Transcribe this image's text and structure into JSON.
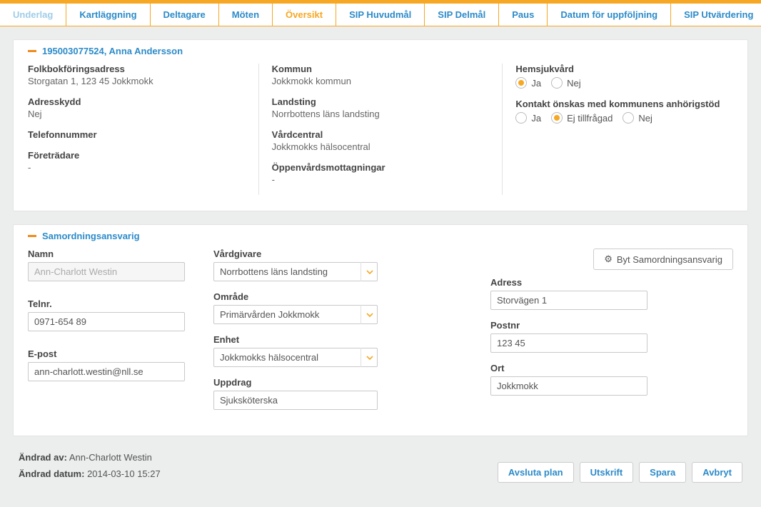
{
  "tabs": {
    "underlag": "Underlag",
    "kartlaggning": "Kartläggning",
    "deltagare": "Deltagare",
    "moten": "Möten",
    "oversikt": "Översikt",
    "sip_huvudmal": "SIP Huvudmål",
    "sip_delmal": "SIP Delmål",
    "paus": "Paus",
    "datum_uppfoljning": "Datum för uppföljning",
    "sip_utvardering": "SIP Utvärdering"
  },
  "patient": {
    "header": "195003077524, Anna Andersson",
    "folkbokforing_lbl": "Folkbokföringsadress",
    "folkbokforing_val": "Storgatan 1, 123 45 Jokkmokk",
    "adresskydd_lbl": "Adresskydd",
    "adresskydd_val": "Nej",
    "telefon_lbl": "Telefonnummer",
    "telefon_val": "",
    "foretradare_lbl": "Företrädare",
    "foretradare_val": "-",
    "kommun_lbl": "Kommun",
    "kommun_val": "Jokkmokk kommun",
    "landsting_lbl": "Landsting",
    "landsting_val": "Norrbottens läns landsting",
    "vardcentral_lbl": "Vårdcentral",
    "vardcentral_val": "Jokkmokks hälsocentral",
    "oppenvard_lbl": "Öppenvårdsmottagningar",
    "oppenvard_val": "-",
    "hemsjukvard_lbl": "Hemsjukvård",
    "kontakt_lbl": "Kontakt önskas med kommunens anhörigstöd",
    "opt_ja": "Ja",
    "opt_nej": "Nej",
    "opt_ej": "Ej tillfrågad"
  },
  "samordning": {
    "title": "Samordningsansvarig",
    "namn_lbl": "Namn",
    "namn_val": "Ann-Charlott Westin",
    "tel_lbl": "Telnr.",
    "tel_val": "0971-654 89",
    "epost_lbl": "E-post",
    "epost_val": "ann-charlott.westin@nll.se",
    "vardgivare_lbl": "Vårdgivare",
    "vardgivare_val": "Norrbottens läns landsting",
    "omrade_lbl": "Område",
    "omrade_val": "Primärvården Jokkmokk",
    "enhet_lbl": "Enhet",
    "enhet_val": "Jokkmokks hälsocentral",
    "uppdrag_lbl": "Uppdrag",
    "uppdrag_val": "Sjuksköterska",
    "byt_btn": "Byt Samordningsansvarig",
    "adress_lbl": "Adress",
    "adress_val": "Storvägen 1",
    "postnr_lbl": "Postnr",
    "postnr_val": "123 45",
    "ort_lbl": "Ort",
    "ort_val": "Jokkmokk"
  },
  "footer": {
    "andrad_av_lbl": "Ändrad av:",
    "andrad_av_val": "Ann-Charlott Westin",
    "andrad_datum_lbl": "Ändrad datum:",
    "andrad_datum_val": "2014-03-10 15:27",
    "avsluta": "Avsluta plan",
    "utskrift": "Utskrift",
    "spara": "Spara",
    "avbryt": "Avbryt"
  }
}
